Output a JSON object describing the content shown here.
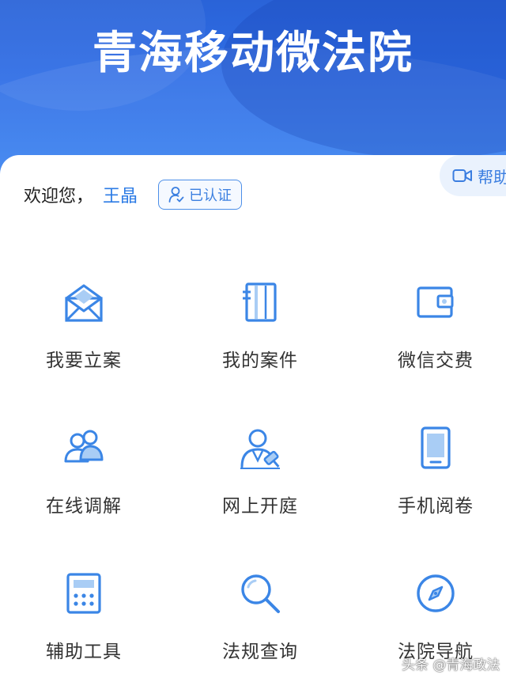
{
  "banner": {
    "title": "青海移动微法院"
  },
  "welcome": {
    "greeting": "欢迎您，",
    "user_name": "王晶",
    "verified_label": "已认证"
  },
  "help": {
    "label": "帮助"
  },
  "menu": [
    {
      "label": "我要立案",
      "icon": "envelope-icon"
    },
    {
      "label": "我的案件",
      "icon": "notebook-icon"
    },
    {
      "label": "微信交费",
      "icon": "wallet-icon"
    },
    {
      "label": "在线调解",
      "icon": "people-icon"
    },
    {
      "label": "网上开庭",
      "icon": "judge-gavel-icon"
    },
    {
      "label": "手机阅卷",
      "icon": "tablet-icon"
    },
    {
      "label": "辅助工具",
      "icon": "calculator-icon"
    },
    {
      "label": "法规查询",
      "icon": "search-icon"
    },
    {
      "label": "法院导航",
      "icon": "compass-icon"
    }
  ],
  "watermark": "头条 @青海政法",
  "colors": {
    "brand_blue": "#2f6ee6",
    "icon_blue": "#3b86e6",
    "name_blue": "#2c7be5"
  }
}
